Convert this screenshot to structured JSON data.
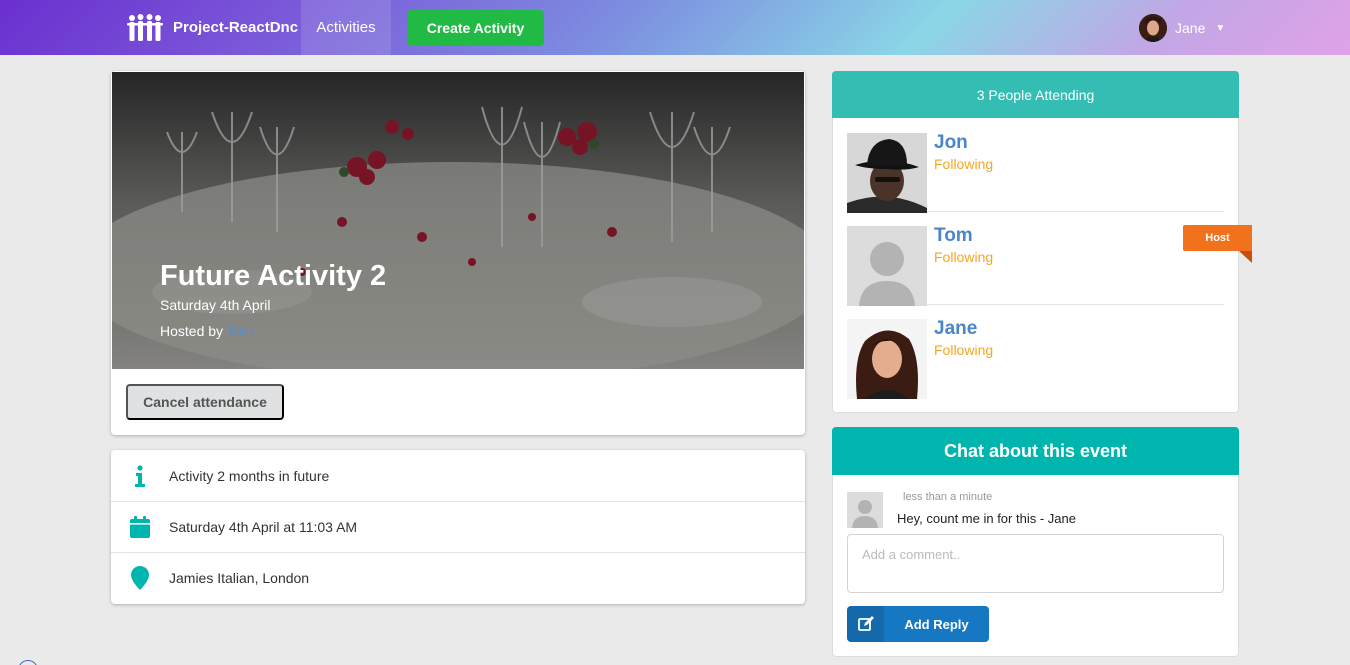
{
  "navbar": {
    "brand": "Project-ReactDnc",
    "activities_label": "Activities",
    "create_label": "Create Activity",
    "user_name": "Jane"
  },
  "activity": {
    "title": "Future Activity 2",
    "date": "Saturday 4th April",
    "hosted_by_prefix": "Hosted by",
    "host_name": "Tom",
    "cancel_label": "Cancel attendance"
  },
  "info": {
    "description": "Activity 2 months in future",
    "datetime": "Saturday 4th April at 11:03 AM",
    "venue": "Jamies Italian, London"
  },
  "attendees": {
    "header": "3 People Attending",
    "host_badge": "Host",
    "list": [
      {
        "name": "Jon",
        "status": "Following"
      },
      {
        "name": "Tom",
        "status": "Following"
      },
      {
        "name": "Jane",
        "status": "Following"
      }
    ]
  },
  "chat": {
    "header": "Chat about this event",
    "comments": [
      {
        "time": "less than a minute",
        "text": "Hey, count me in for this - Jane"
      }
    ],
    "placeholder": "Add a comment..",
    "reply_label": "Add Reply"
  },
  "colors": {
    "create_green": "#21ba45",
    "teal": "#00b5ad",
    "host_orange": "#f2711c",
    "link_blue": "#4a86c8",
    "following_orange": "#f5a623",
    "reply_blue": "#1678c2"
  }
}
